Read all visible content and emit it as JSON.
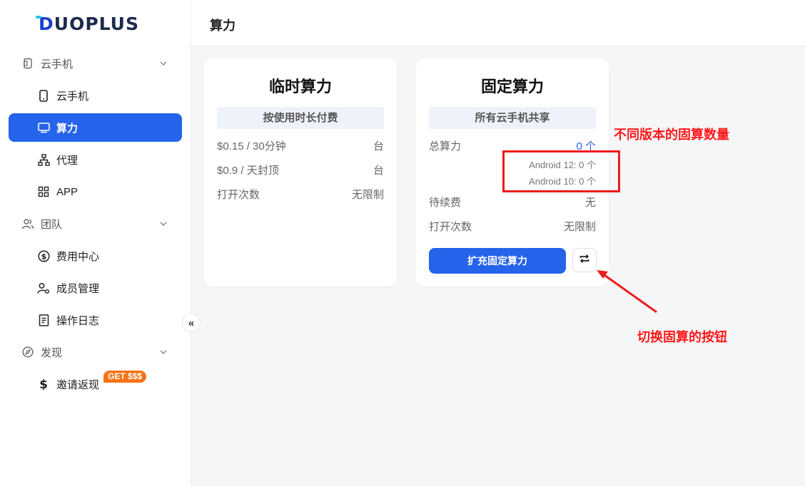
{
  "brand": {
    "logo_text": "DUOPLUS"
  },
  "sidebar": {
    "groups": [
      {
        "label": "云手机",
        "icon": "phone-outline-icon"
      },
      {
        "label": "团队",
        "icon": "users-icon"
      },
      {
        "label": "发现",
        "icon": "compass-icon"
      }
    ],
    "items": [
      {
        "label": "云手机",
        "icon": "phone-icon"
      },
      {
        "label": "算力",
        "icon": "monitor-icon",
        "active": true
      },
      {
        "label": "代理",
        "icon": "network-icon"
      },
      {
        "label": "APP",
        "icon": "grid-icon"
      },
      {
        "label": "费用中心",
        "icon": "dollar-circle-icon"
      },
      {
        "label": "成员管理",
        "icon": "user-gear-icon"
      },
      {
        "label": "操作日志",
        "icon": "document-icon"
      },
      {
        "label": "邀请返现",
        "icon": "dollar-icon"
      }
    ],
    "promo_badge": "GET $$$",
    "collapse_symbol": "«"
  },
  "header": {
    "title": "算力"
  },
  "temp_card": {
    "title": "临时算力",
    "subtitle": "按使用时长付费",
    "rows": [
      {
        "label": "$0.15 / 30分钟",
        "value": "台"
      },
      {
        "label": "$0.9 / 天封顶",
        "value": "台"
      },
      {
        "label": "打开次数",
        "value": "无限制"
      }
    ]
  },
  "fixed_card": {
    "title": "固定算力",
    "subtitle": "所有云手机共享",
    "total_label": "总算力",
    "total_value": "0 个",
    "versions": [
      {
        "text": "Android 12:  0 个"
      },
      {
        "text": "Android 10:  0 个"
      }
    ],
    "rows": [
      {
        "label": "待续费",
        "value": "无"
      },
      {
        "label": "打开次数",
        "value": "无限制"
      }
    ],
    "expand_button": "扩充固定算力",
    "switch_icon": "switch-arrows-icon"
  },
  "annotations": {
    "versions_note": "不同版本的固算数量",
    "switch_note": "切换固算的按钮",
    "color": "#ff1a1a"
  },
  "colors": {
    "accent": "#2563eb",
    "badge": "#f97316"
  }
}
